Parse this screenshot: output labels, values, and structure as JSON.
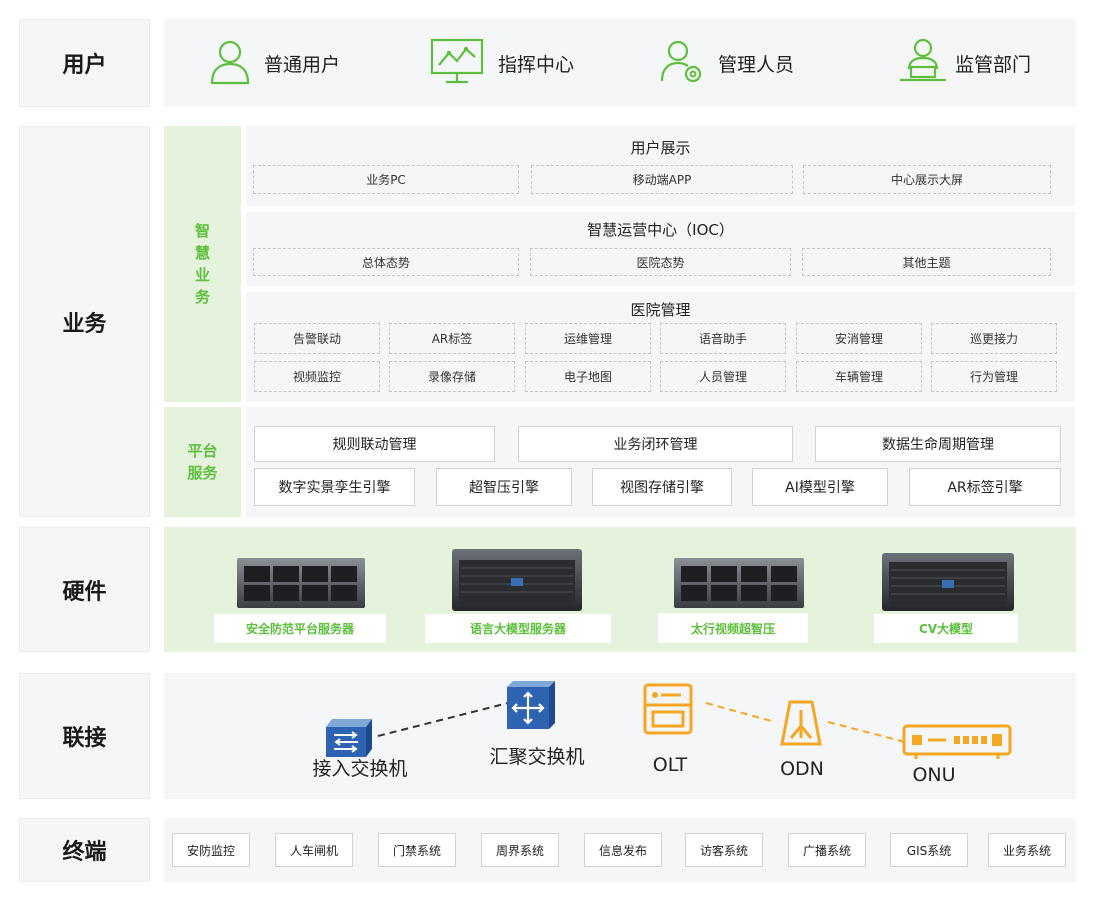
{
  "layers": {
    "user": "用户",
    "business": "业务",
    "hardware": "硬件",
    "connect": "联接",
    "terminal": "终端"
  },
  "users": [
    {
      "label": "普通用户",
      "icon": "user-icon"
    },
    {
      "label": "指挥中心",
      "icon": "monitor-chart-icon"
    },
    {
      "label": "管理人员",
      "icon": "user-gear-icon"
    },
    {
      "label": "监管部门",
      "icon": "user-laptop-icon"
    }
  ],
  "business": {
    "smart_label": "智慧业务",
    "platform_label": "平台服务",
    "user_display": {
      "title": "用户展示",
      "items": [
        "业务PC",
        "移动端APP",
        "中心展示大屏"
      ]
    },
    "ioc": {
      "title": "智慧运营中心（IOC）",
      "items": [
        "总体态势",
        "医院态势",
        "其他主题"
      ]
    },
    "hospital": {
      "title": "医院管理",
      "row1": [
        "告警联动",
        "AR标签",
        "运维管理",
        "语音助手",
        "安消管理",
        "巡更接力"
      ],
      "row2": [
        "视频监控",
        "录像存储",
        "电子地图",
        "人员管理",
        "车辆管理",
        "行为管理"
      ]
    },
    "platform": {
      "row1": [
        "规则联动管理",
        "业务闭环管理",
        "数据生命周期管理"
      ],
      "row2": [
        "数字实景孪生引擎",
        "超智压引擎",
        "视图存储引擎",
        "AI模型引擎",
        "AR标签引擎"
      ]
    }
  },
  "hardware": [
    "安全防范平台服务器",
    "语言大模型服务器",
    "太行视频超智压",
    "CV大模型"
  ],
  "network": {
    "access_switch": "接入交换机",
    "agg_switch": "汇聚交换机",
    "olt": "OLT",
    "odn": "ODN",
    "onu": "ONU"
  },
  "terminals": [
    "安防监控",
    "人车闸机",
    "门禁系统",
    "周界系统",
    "信息发布",
    "访客系统",
    "广播系统",
    "GIS系统",
    "业务系统"
  ],
  "colors": {
    "green": "#5cc03c",
    "green_bg": "#e5f3dd",
    "orange": "#f5a623",
    "panel_bg": "#f5f6f8"
  }
}
